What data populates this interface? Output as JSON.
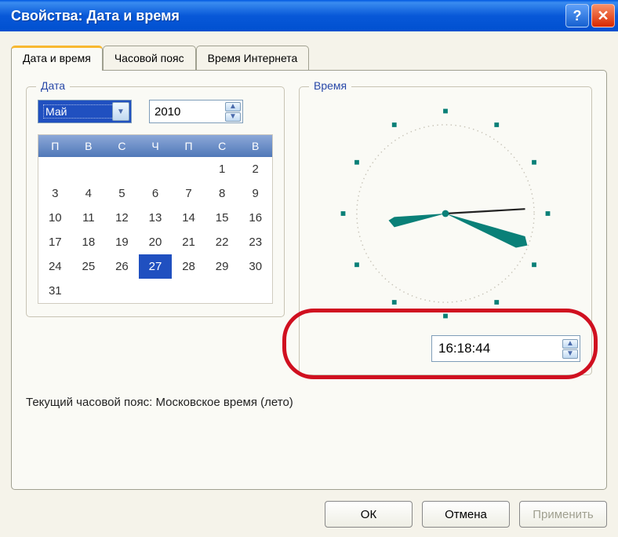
{
  "window": {
    "title": "Свойства: Дата и время"
  },
  "tabs": [
    {
      "label": "Дата и время",
      "active": true
    },
    {
      "label": "Часовой пояс",
      "active": false
    },
    {
      "label": "Время Интернета",
      "active": false
    }
  ],
  "date_section": {
    "legend": "Дата",
    "month": "Май",
    "year": "2010",
    "weekdays": [
      "П",
      "В",
      "С",
      "Ч",
      "П",
      "С",
      "В"
    ],
    "days": [
      [
        "",
        "",
        "",
        "",
        "",
        "1",
        "2"
      ],
      [
        "3",
        "4",
        "5",
        "6",
        "7",
        "8",
        "9"
      ],
      [
        "10",
        "11",
        "12",
        "13",
        "14",
        "15",
        "16"
      ],
      [
        "17",
        "18",
        "19",
        "20",
        "21",
        "22",
        "23"
      ],
      [
        "24",
        "25",
        "26",
        "27",
        "28",
        "29",
        "30"
      ],
      [
        "31",
        "",
        "",
        "",
        "",
        "",
        ""
      ]
    ],
    "selected_day": "27"
  },
  "time_section": {
    "legend": "Время",
    "time_value": "16:18:44"
  },
  "timezone_text": "Текущий часовой пояс: Московское время (лето)",
  "buttons": {
    "ok": "ОК",
    "cancel": "Отмена",
    "apply": "Применить"
  }
}
